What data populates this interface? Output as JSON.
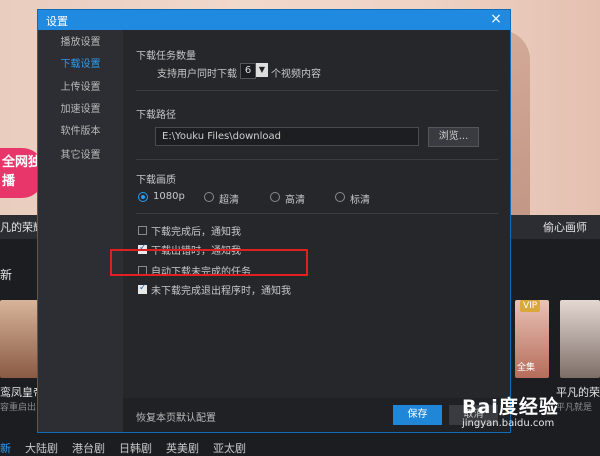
{
  "background": {
    "badge_text": "全网独播",
    "strip_left": "凡的荣耀",
    "strip_right": "偷心画师",
    "section_title": "新",
    "card_left_title": "鸾凤皇帝",
    "card_left_sub": "容重启出",
    "card_right_badge": "VIP",
    "card_right_tag": "全集",
    "card_right_title": "平凡的荣",
    "card_right_sub": "平凡就是",
    "categories": [
      "新",
      "大陆剧",
      "港台剧",
      "日韩剧",
      "英美剧",
      "亚太剧"
    ]
  },
  "watermark": {
    "logo": "Bai度经验",
    "url": "jingyan.baidu.com"
  },
  "dialog": {
    "title": "设置",
    "close_icon": "×",
    "nav": [
      "播放设置",
      "下载设置",
      "上传设置",
      "加速设置",
      "软件版本",
      "其它设置"
    ],
    "active_nav": "下载设置",
    "task_count": {
      "title": "下载任务数量",
      "prefix": "支持用户同时下载",
      "value": "6",
      "suffix": "个视频内容"
    },
    "path": {
      "title": "下载路径",
      "value": "E:\\Youku Files\\download",
      "browse_label": "浏览..."
    },
    "quality": {
      "title": "下载画质",
      "options": [
        "1080p",
        "超清",
        "高清",
        "标清"
      ],
      "selected": "1080p"
    },
    "options": [
      {
        "label": "下载完成后，通知我",
        "checked": false
      },
      {
        "label": "下载出错时，通知我",
        "checked": true
      },
      {
        "label": "自动下载未完成的任务",
        "checked": false
      },
      {
        "label": "未下载完成退出程序时，通知我",
        "checked": true
      }
    ],
    "footer": {
      "reset_label": "恢复本页默认配置",
      "save_label": "保存",
      "cancel_label": "取消"
    },
    "colors": {
      "accent": "#1f8ae0",
      "highlight": "#e02020"
    }
  }
}
